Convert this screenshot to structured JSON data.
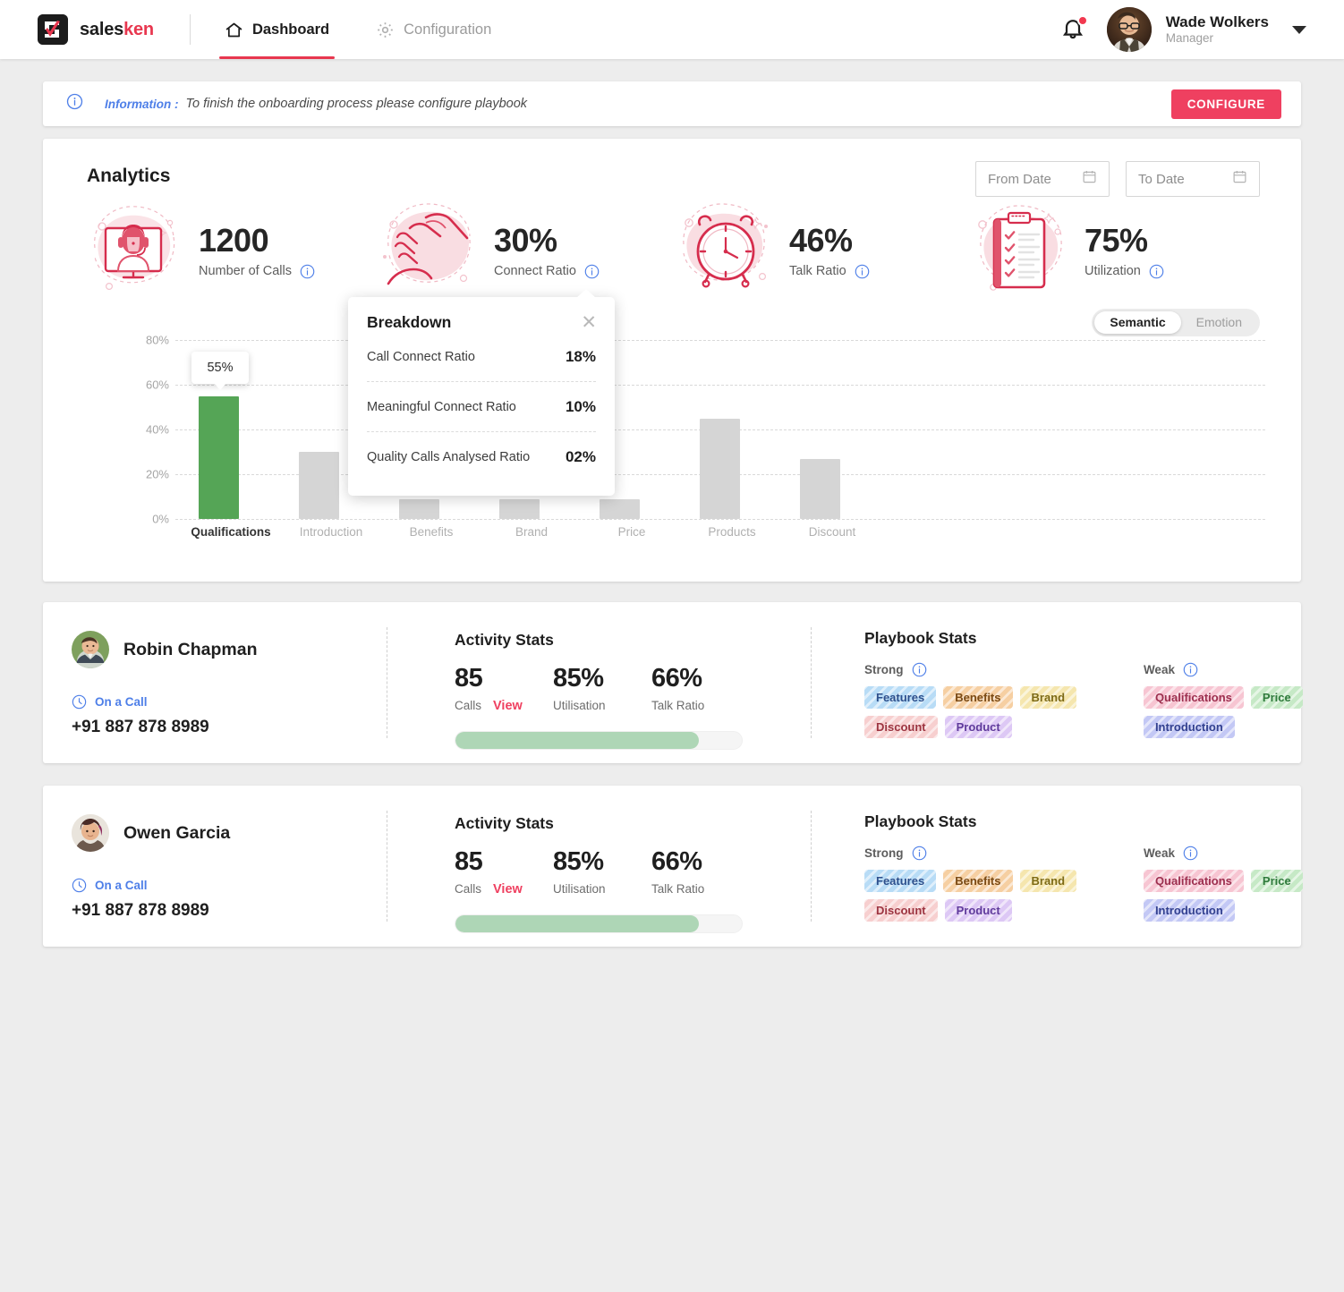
{
  "header": {
    "brand": {
      "part1": "sales",
      "part2": "ken",
      "icon": "salesken-logo-icon"
    },
    "nav": [
      {
        "label": "Dashboard",
        "icon": "home-icon",
        "active": true
      },
      {
        "label": "Configuration",
        "icon": "gear-icon",
        "active": false
      }
    ],
    "notification_icon": "bell-icon",
    "user": {
      "name": "Wade Wolkers",
      "role": "Manager",
      "avatar": "user-avatar"
    },
    "caret_icon": "chevron-down-icon"
  },
  "banner": {
    "icon": "info-circle-icon",
    "label": "Information :",
    "message": "To finish the onboarding process please configure playbook",
    "button": "CONFIGURE",
    "button_color": "#ef4060"
  },
  "analytics": {
    "title": "Analytics",
    "from_date_placeholder": "From Date",
    "to_date_placeholder": "To Date",
    "calendar_icon": "calendar-icon",
    "kpis": [
      {
        "value": "1200",
        "label": "Number of Calls",
        "art": "headset-agent-illustration",
        "info_icon": "info-circle-icon"
      },
      {
        "value": "30%",
        "label": "Connect Ratio",
        "art": "handshake-illustration",
        "info_icon": "info-circle-icon"
      },
      {
        "value": "46%",
        "label": "Talk Ratio",
        "art": "alarm-clock-illustration",
        "info_icon": "info-circle-icon"
      },
      {
        "value": "75%",
        "label": "Utilization",
        "art": "checklist-clipboard-illustration",
        "info_icon": "info-circle-icon"
      }
    ],
    "toggle": {
      "options": [
        "Semantic",
        "Emotion"
      ],
      "selected": "Semantic"
    }
  },
  "breakdown": {
    "title": "Breakdown",
    "close_icon": "close-icon",
    "rows": [
      {
        "label": "Call Connect Ratio",
        "value": "18%"
      },
      {
        "label": "Meaningful Connect Ratio",
        "value": "10%"
      },
      {
        "label": "Quality Calls Analysed Ratio",
        "value": "02%"
      }
    ]
  },
  "chart_data": {
    "type": "bar",
    "title": "Analytics",
    "xlabel": "",
    "ylabel": "",
    "ylim": [
      0,
      80
    ],
    "grid": true,
    "yticks": [
      "0%",
      "20%",
      "40%",
      "60%",
      "80%"
    ],
    "ytick_values": [
      0,
      20,
      40,
      60,
      80
    ],
    "categories": [
      "Qualifications",
      "Introduction",
      "Benefits",
      "Brand",
      "Price",
      "Products",
      "Discount"
    ],
    "values": [
      55,
      30,
      9,
      9,
      9,
      45,
      27
    ],
    "highlight_index": 0,
    "highlight_label": "55%",
    "highlight_color": "#55a556",
    "bar_color": "#d5d5d5",
    "legend": []
  },
  "agents": [
    {
      "name": "Robin Chapman",
      "avatar": "agent-avatar",
      "status": "On a Call",
      "status_icon": "clock-icon",
      "phone": "+91 887 878 8989",
      "activity": {
        "title": "Activity Stats",
        "stats": [
          {
            "value": "85",
            "label": "Calls",
            "action": "View"
          },
          {
            "value": "85%",
            "label": "Utilisation"
          },
          {
            "value": "66%",
            "label": "Talk Ratio"
          }
        ],
        "progress_percent": 85
      },
      "playbook": {
        "title": "Playbook Stats",
        "strong_label": "Strong",
        "weak_label": "Weak",
        "info_icon": "info-circle-icon",
        "strong": [
          {
            "label": "Features",
            "bg": "#b8dcf6",
            "fg": "#2c4f8c"
          },
          {
            "label": "Benefits",
            "bg": "#f6cfa2",
            "fg": "#7a4a15"
          },
          {
            "label": "Brand",
            "bg": "#f5e6ae",
            "fg": "#7c6a16"
          },
          {
            "label": "Discount",
            "bg": "#f7cfcf",
            "fg": "#9c3440"
          },
          {
            "label": "Product",
            "bg": "#ddc8f5",
            "fg": "#5f3a9b"
          }
        ],
        "weak": [
          {
            "label": "Qualifications",
            "bg": "#f7c5d2",
            "fg": "#9c2f4f"
          },
          {
            "label": "Price",
            "bg": "#c6e9c6",
            "fg": "#2f7a3c"
          },
          {
            "label": "Introduction",
            "bg": "#c3c8f5",
            "fg": "#32408f"
          }
        ]
      }
    },
    {
      "name": "Owen Garcia",
      "avatar": "agent-avatar",
      "status": "On a Call",
      "status_icon": "clock-icon",
      "phone": "+91 887 878 8989",
      "activity": {
        "title": "Activity Stats",
        "stats": [
          {
            "value": "85",
            "label": "Calls",
            "action": "View"
          },
          {
            "value": "85%",
            "label": "Utilisation"
          },
          {
            "value": "66%",
            "label": "Talk Ratio"
          }
        ],
        "progress_percent": 85
      },
      "playbook": {
        "title": "Playbook Stats",
        "strong_label": "Strong",
        "weak_label": "Weak",
        "info_icon": "info-circle-icon",
        "strong": [
          {
            "label": "Features",
            "bg": "#b8dcf6",
            "fg": "#2c4f8c"
          },
          {
            "label": "Benefits",
            "bg": "#f6cfa2",
            "fg": "#7a4a15"
          },
          {
            "label": "Brand",
            "bg": "#f5e6ae",
            "fg": "#7c6a16"
          },
          {
            "label": "Discount",
            "bg": "#f7cfcf",
            "fg": "#9c3440"
          },
          {
            "label": "Product",
            "bg": "#ddc8f5",
            "fg": "#5f3a9b"
          }
        ],
        "weak": [
          {
            "label": "Qualifications",
            "bg": "#f7c5d2",
            "fg": "#9c2f4f"
          },
          {
            "label": "Price",
            "bg": "#c6e9c6",
            "fg": "#2f7a3c"
          },
          {
            "label": "Introduction",
            "bg": "#c3c8f5",
            "fg": "#32408f"
          }
        ]
      }
    }
  ]
}
